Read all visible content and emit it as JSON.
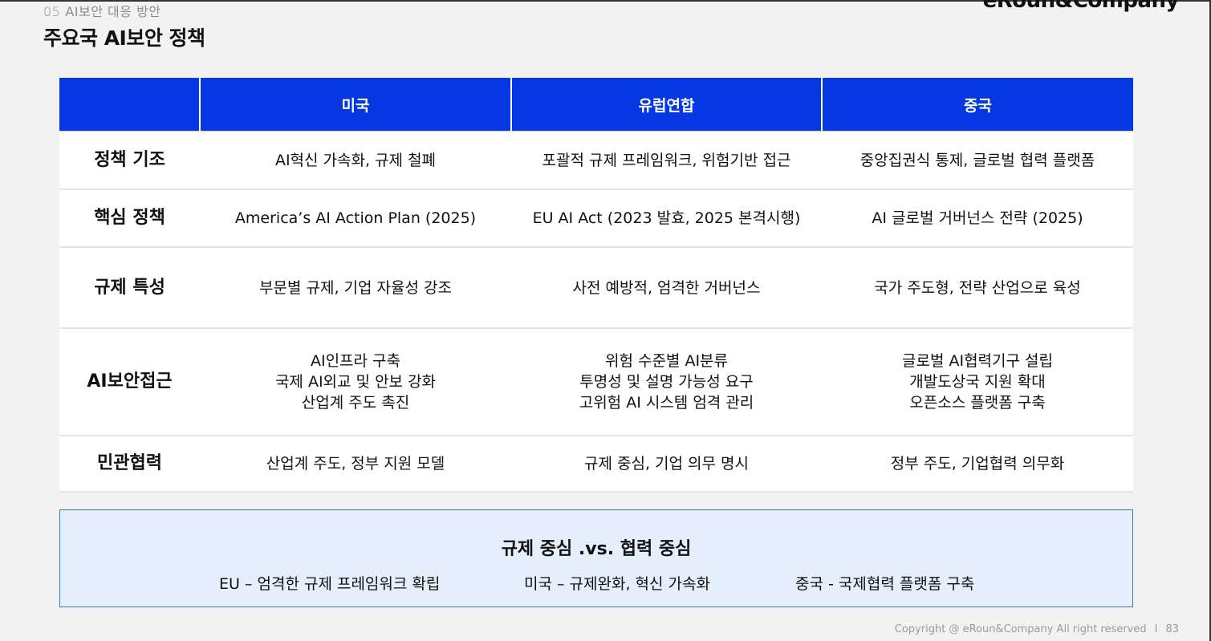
{
  "header": {
    "section_number": "05",
    "section_name": "AI보안 대응 방안",
    "brand": "eRoun&Company",
    "title": "주요국 AI보안 정책"
  },
  "table": {
    "columns": [
      "",
      "미국",
      "유럽연합",
      "중국"
    ],
    "rows": [
      {
        "label": "정책 기조",
        "cells": [
          [
            "AI혁신 가속화, 규제 철폐"
          ],
          [
            "포괄적 규제 프레임워크, 위험기반 접근"
          ],
          [
            "중앙집권식 통제, 글로벌 협력 플랫폼"
          ]
        ]
      },
      {
        "label": "핵심 정책",
        "cells": [
          [
            "America’s AI Action Plan (2025)"
          ],
          [
            "EU AI Act (2023 발효, 2025 본격시행)"
          ],
          [
            "AI 글로벌 거버넌스 전략 (2025)"
          ]
        ]
      },
      {
        "label": "규제 특성",
        "cells": [
          [
            "부문별 규제, 기업 자율성 강조"
          ],
          [
            "사전 예방적, 엄격한 거버넌스"
          ],
          [
            "국가 주도형, 전략 산업으로 육성"
          ]
        ]
      },
      {
        "label": "AI보안접근",
        "cells": [
          [
            "AI인프라 구축",
            "국제 AI외교 및 안보 강화",
            "산업계 주도 촉진"
          ],
          [
            "위험 수준별 AI분류",
            "투명성 및 설명 가능성 요구",
            "고위험 AI 시스템 엄격 관리"
          ],
          [
            "글로벌 AI협력기구 설립",
            "개발도상국 지원 확대",
            "오픈소스 플랫폼 구축"
          ]
        ]
      },
      {
        "label": "민관협력",
        "cells": [
          [
            "산업계 주도, 정부 지원 모델"
          ],
          [
            "규제 중심, 기업 의무 명시"
          ],
          [
            "정부 주도, 기업협력 의무화"
          ]
        ]
      }
    ]
  },
  "summary": {
    "title": "규제 중심 .vs. 협력 중심",
    "items": [
      "EU – 엄격한 규제 프레임워크 확립",
      "미국 – 규제완화, 혁신 가속화",
      "중국  - 국제협력 플랫폼 구축"
    ]
  },
  "footer": {
    "copyright": "Copyright @ eRoun&Company All right reserved",
    "separator": "I",
    "page_number": "83"
  }
}
